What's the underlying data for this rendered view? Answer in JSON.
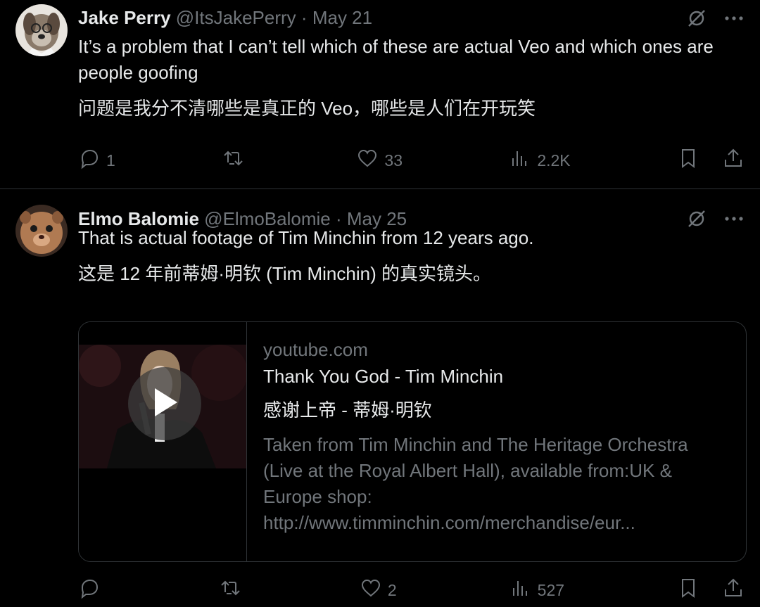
{
  "tweets": [
    {
      "name": "Jake Perry",
      "handle": "@ItsJakePerry",
      "separator": "·",
      "date": "May 21",
      "text_en": "It’s a problem that I can’t tell which of these are actual Veo and which ones are people goofing",
      "text_zh": "问题是我分不清哪些是真正的 Veo，哪些是人们在开玩笑",
      "replies": "1",
      "reposts": "",
      "likes": "33",
      "views": "2.2K"
    },
    {
      "name": "Elmo Balomie",
      "handle": "@ElmoBalomie",
      "separator": "·",
      "date": "May 25",
      "text_en": "That is actual footage of Tim Minchin from 12 years ago.",
      "text_zh": "这是 12 年前蒂姆·明钦 (Tim Minchin) 的真实镜头。",
      "replies": "",
      "reposts": "",
      "likes": "2",
      "views": "527",
      "card": {
        "domain": "youtube.com",
        "title": "Thank You God - Tim Minchin",
        "title_zh": "感谢上帝 - 蒂姆·明钦",
        "description": "Taken from Tim Minchin and The Heritage Orchestra (Live at the Royal Albert Hall), available from:UK & Europe shop: http://www.timminchin.com/merchandise/eur..."
      }
    }
  ],
  "colors": {
    "background": "#000000",
    "text": "#e7e9ea",
    "muted": "#71767b",
    "border": "#2f3336"
  },
  "icons": [
    "grok-icon",
    "more-icon",
    "reply-icon",
    "repost-icon",
    "like-icon",
    "views-icon",
    "bookmark-icon",
    "share-icon",
    "play-icon"
  ]
}
